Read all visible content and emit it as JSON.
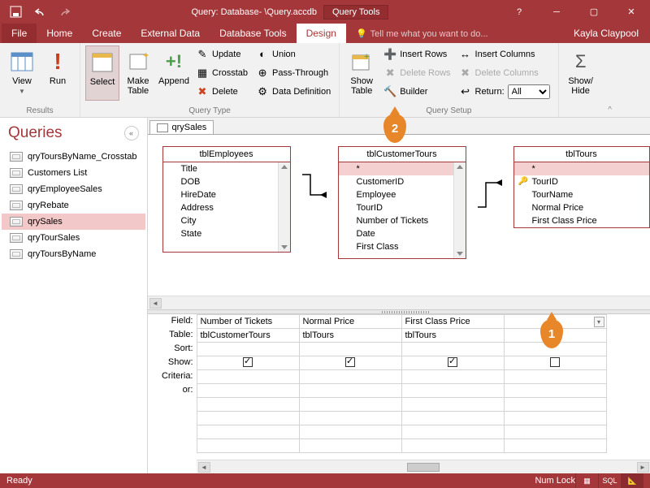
{
  "title": {
    "main": "Query: Database- \\Query.accdb",
    "tools": "Query Tools",
    "help": "?",
    "user": "Kayla Claypool"
  },
  "tabs": {
    "file": "File",
    "home": "Home",
    "create": "Create",
    "external": "External Data",
    "dbtools": "Database Tools",
    "design": "Design",
    "tellme": "Tell me what you want to do..."
  },
  "ribbon": {
    "results": {
      "view": "View",
      "run": "Run",
      "label": "Results"
    },
    "querytype": {
      "select": "Select",
      "maketable": "Make\nTable",
      "append": "Append",
      "update": "Update",
      "crosstab": "Crosstab",
      "delete": "Delete",
      "union": "Union",
      "passthrough": "Pass-Through",
      "datadef": "Data Definition",
      "label": "Query Type"
    },
    "showtable": {
      "btn": "Show\nTable",
      "insertrows": "Insert Rows",
      "deleterows": "Delete Rows",
      "builder": "Builder",
      "insertcols": "Insert Columns",
      "deletecols": "Delete Columns",
      "return": "Return:",
      "returnval": "All",
      "label": "Query Setup"
    },
    "showhide": {
      "btn": "Show/\nHide"
    }
  },
  "nav": {
    "title": "Queries",
    "items": [
      "qryToursByName_Crosstab",
      "Customers List",
      "qryEmployeeSales",
      "qryRebate",
      "qrySales",
      "qryTourSales",
      "qryToursByName"
    ],
    "selected": 4
  },
  "doc": {
    "tab": "qrySales"
  },
  "tables": {
    "emp": {
      "title": "tblEmployees",
      "fields": [
        "Title",
        "DOB",
        "HireDate",
        "Address",
        "City",
        "State"
      ]
    },
    "cust": {
      "title": "tblCustomerTours",
      "fields": [
        "*",
        "CustomerID",
        "Employee",
        "TourID",
        "Number of Tickets",
        "Date",
        "First Class"
      ],
      "star": 0
    },
    "tours": {
      "title": "tblTours",
      "fields": [
        "*",
        "TourID",
        "TourName",
        "Normal Price",
        "First Class Price"
      ],
      "star": 0,
      "key": 1
    }
  },
  "grid": {
    "labels": [
      "Field:",
      "Table:",
      "Sort:",
      "Show:",
      "Criteria:",
      "or:"
    ],
    "cols": [
      {
        "field": "Number of Tickets",
        "table": "tblCustomerTours",
        "show": true
      },
      {
        "field": "Normal Price",
        "table": "tblTours",
        "show": true
      },
      {
        "field": "First Class Price",
        "table": "tblTours",
        "show": true
      },
      {
        "field": "",
        "table": "",
        "show": false
      }
    ]
  },
  "status": {
    "ready": "Ready",
    "numlock": "Num Lock",
    "sql": "SQL"
  },
  "callouts": {
    "c1": "1",
    "c2": "2"
  }
}
